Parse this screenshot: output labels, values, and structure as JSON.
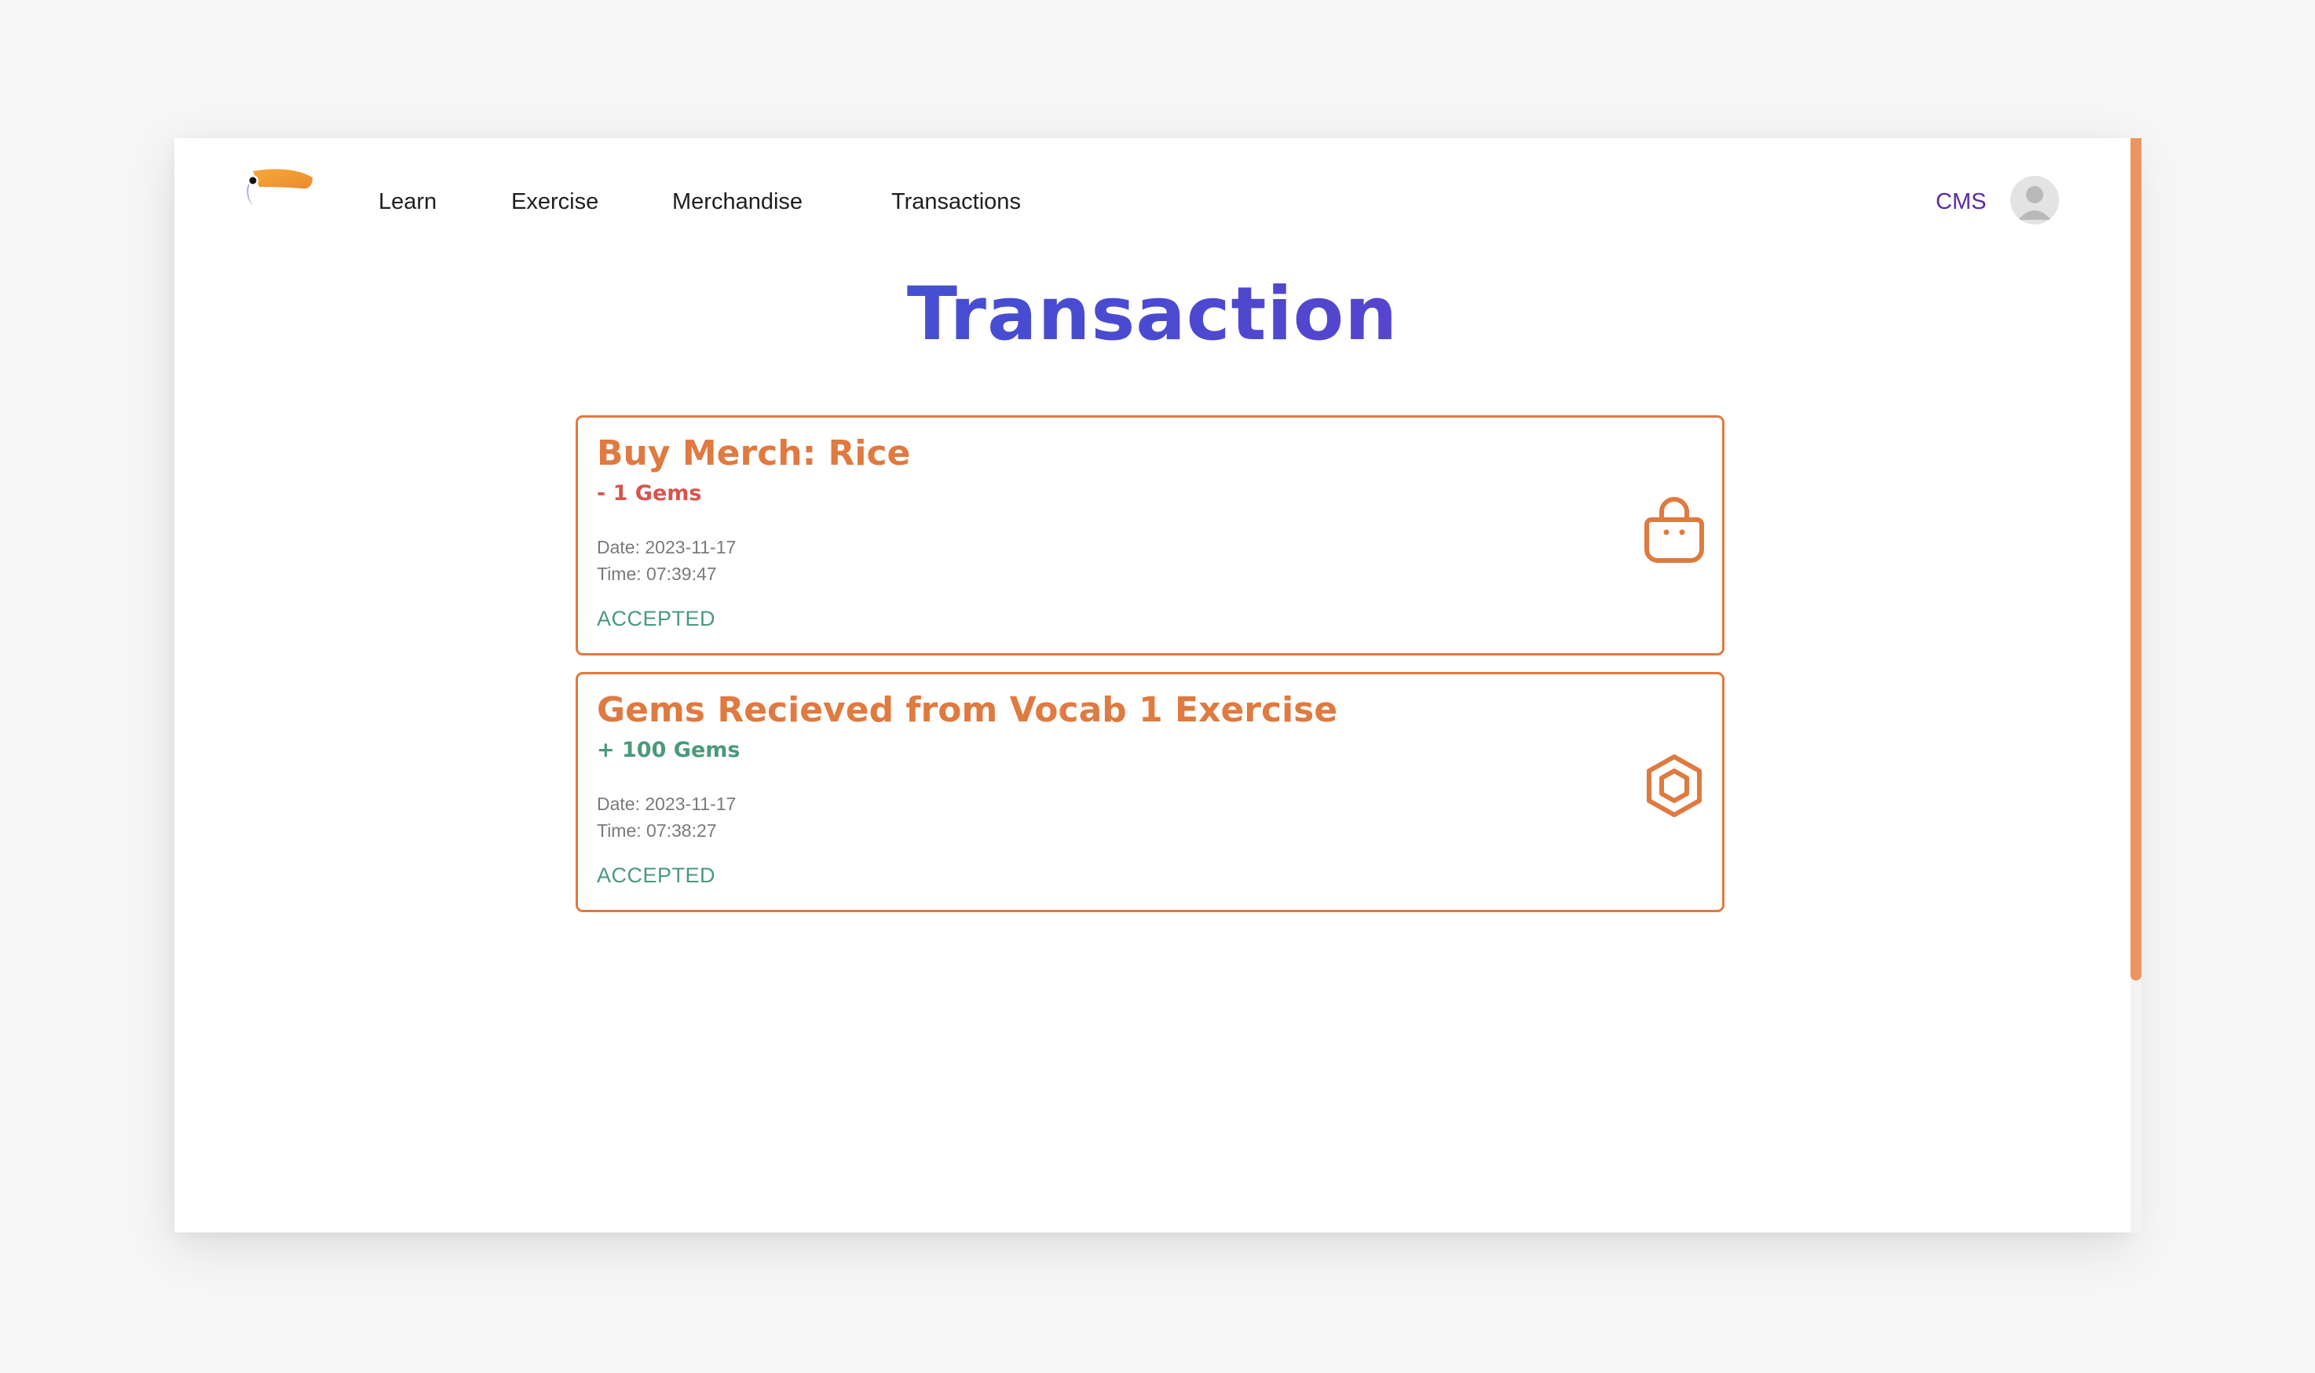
{
  "nav": {
    "items": [
      {
        "label": "Learn"
      },
      {
        "label": "Exercise"
      },
      {
        "label": "Merchandise"
      },
      {
        "label": "Transactions"
      }
    ],
    "cms_label": "CMS"
  },
  "page": {
    "title": "Transaction"
  },
  "transactions": [
    {
      "title": "Buy Merch: Rice",
      "amount": "- 1 Gems",
      "date": "Date: 2023-11-17",
      "time": "Time: 07:39:47",
      "status": "ACCEPTED",
      "icon": "shopping-bag-icon"
    },
    {
      "title": "Gems Recieved from Vocab 1 Exercise",
      "amount": "+ 100 Gems",
      "date": "Date: 2023-11-17",
      "time": "Time: 07:38:27",
      "status": "ACCEPTED",
      "icon": "gem-hexagon-icon"
    }
  ],
  "colors": {
    "accent": "#df7a40",
    "title_gradient_start": "#3a5bd6",
    "title_gradient_end": "#7a35c6",
    "negative": "#d9544c",
    "positive": "#4a9a7a",
    "cms": "#5a2aa6",
    "scrollbar": "#ee9460"
  }
}
